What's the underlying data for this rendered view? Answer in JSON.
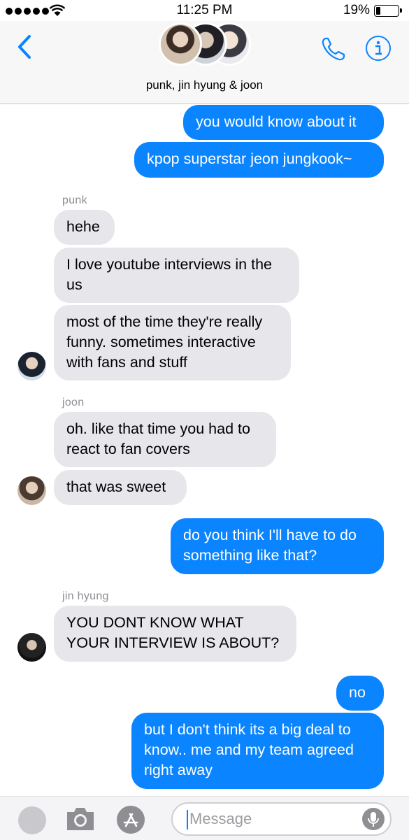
{
  "status_bar": {
    "time": "11:25 PM",
    "battery_percent": "19%",
    "battery_level": 0.19,
    "signal_bars": 5
  },
  "header": {
    "group_name": "punk, jin hyung & joon",
    "back_icon": "chevron-left-icon",
    "call_icon": "phone-icon",
    "info_icon": "info-icon",
    "accent_color": "#0a84ff"
  },
  "messages": [
    {
      "direction": "outgoing",
      "text": "you would know about it"
    },
    {
      "direction": "outgoing",
      "text": "kpop superstar jeon jungkook~"
    },
    {
      "sender": "punk"
    },
    {
      "direction": "incoming",
      "text": "hehe"
    },
    {
      "direction": "incoming",
      "lines": [
        "I love youtube interviews in the",
        "us"
      ]
    },
    {
      "direction": "incoming",
      "lines": [
        "most of the time they're really",
        "funny. sometimes interactive",
        "with fans and stuff"
      ]
    },
    {
      "sender": "joon"
    },
    {
      "direction": "incoming",
      "lines": [
        "oh. like that time you had to",
        "react to fan covers"
      ]
    },
    {
      "direction": "incoming",
      "text": "that was sweet"
    },
    {
      "direction": "outgoing",
      "lines": [
        "do you think I'll have to do",
        "something like that?"
      ]
    },
    {
      "sender": "jin hyung"
    },
    {
      "direction": "incoming",
      "lines": [
        "YOU DONT KNOW WHAT",
        "YOUR INTERVIEW IS ABOUT?"
      ]
    },
    {
      "direction": "outgoing",
      "text": "no"
    },
    {
      "direction": "outgoing",
      "lines": [
        "but I don't think its a big deal to",
        "know.. me and my team agreed",
        "right away"
      ]
    }
  ],
  "compose": {
    "placeholder": "Message",
    "value": "",
    "camera_icon": "camera-icon",
    "appstore_icon": "app-store-icon",
    "mic_icon": "microphone-icon"
  },
  "colors": {
    "outgoing_bubble": "#0a84ff",
    "incoming_bubble": "#e6e6eb",
    "sender_label": "#8e8e93"
  }
}
